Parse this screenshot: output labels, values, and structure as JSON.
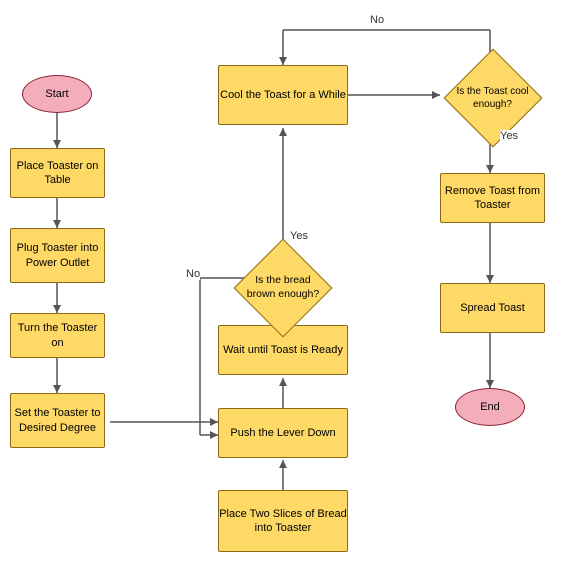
{
  "nodes": {
    "start": {
      "label": "Start"
    },
    "place_toaster": {
      "label": "Place Toaster on Table"
    },
    "plug_toaster": {
      "label": "Plug Toaster into Power Outlet"
    },
    "turn_on": {
      "label": "Turn the Toaster on"
    },
    "set_degree": {
      "label": "Set the Toaster to Desired Degree"
    },
    "place_slices": {
      "label": "Place Two Slices of Bread into Toaster"
    },
    "push_lever": {
      "label": "Push the Lever Down"
    },
    "wait_toast": {
      "label": "Wait until Toast is Ready"
    },
    "is_brown": {
      "label": "Is the bread brown enough?"
    },
    "cool_toast": {
      "label": "Cool the Toast for a While"
    },
    "is_cool": {
      "label": "Is the Toast cool enough?"
    },
    "remove_toast": {
      "label": "Remove Toast from Toaster"
    },
    "spread_toast": {
      "label": "Spread Toast"
    },
    "end": {
      "label": "End"
    }
  },
  "labels": {
    "yes": "Yes",
    "no": "No"
  }
}
